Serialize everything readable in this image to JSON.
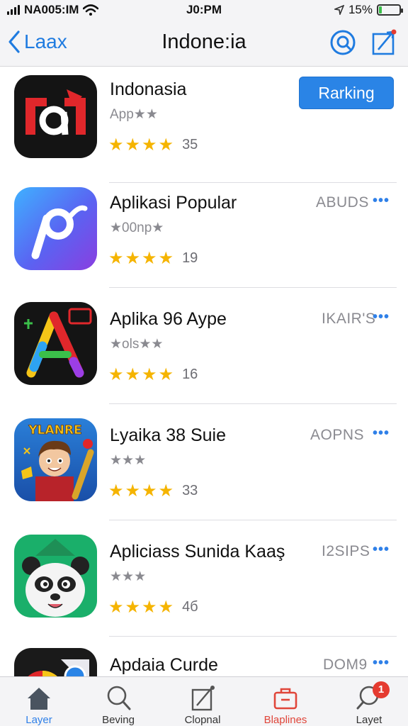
{
  "status_bar": {
    "carrier": "NA005:IM",
    "time": "J0:PM",
    "battery_percent": "15%",
    "battery_level": 0.15,
    "icons": [
      "signal-icon",
      "wifi-icon",
      "location-arrow-icon",
      "battery-icon"
    ]
  },
  "nav": {
    "back_label": "Laax",
    "title": "Indone:ia",
    "icons": [
      "back-chevron-icon",
      "search-icon",
      "share-icon"
    ],
    "accent_color": "#1f7be0"
  },
  "apps": [
    {
      "name": "Indonasia",
      "subtitle": "App★★",
      "rating": 4,
      "rating_count": "35",
      "action": "Rarking",
      "action_type": "button"
    },
    {
      "name": "Aplikasi Popular",
      "subtitle": "★00np★",
      "rating": 4,
      "rating_count": "19",
      "action": "ABUDS",
      "more": "•••"
    },
    {
      "name": "Aplika 96 Aype",
      "subtitle": "★ols★★",
      "rating": 4,
      "rating_count": "16",
      "action": "IKAIR'S",
      "more": "•••"
    },
    {
      "name": "Ŀyaika 38 Suie",
      "subtitle": "★★★",
      "rating": 4,
      "rating_count": "33",
      "action": "AOPNS",
      "more": "•••",
      "icon_text": "YLANRE"
    },
    {
      "name": "Apliciass Sunida Kaaş",
      "subtitle": "★★★",
      "rating": 4,
      "rating_count": "4б",
      "action": "I2SIPS",
      "more": "•••"
    },
    {
      "name": "Apdaia Curde",
      "action": "DOM9",
      "more": "•••"
    }
  ],
  "tabs": [
    {
      "label": "Layer",
      "icon": "home-icon",
      "state": "active"
    },
    {
      "label": "Beving",
      "icon": "search-icon",
      "state": "normal"
    },
    {
      "label": "Clopnal",
      "icon": "compose-icon",
      "state": "normal"
    },
    {
      "label": "Blaplines",
      "icon": "briefcase-icon",
      "state": "red"
    },
    {
      "label": "Layet",
      "icon": "search-badge-icon",
      "state": "normal",
      "badge": "1"
    }
  ],
  "star_color": "#f5b400",
  "button_color": "#2a84e6"
}
